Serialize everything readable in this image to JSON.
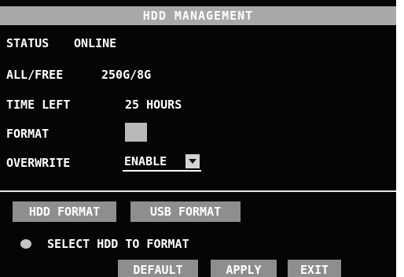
{
  "title": "HDD MANAGEMENT",
  "status": {
    "label": "STATUS",
    "value": "ONLINE"
  },
  "capacity": {
    "label": "ALL/FREE",
    "value": "250G/8G"
  },
  "time_left": {
    "label": "TIME LEFT",
    "value": "25 HOURS"
  },
  "format": {
    "label": "FORMAT",
    "checked": false
  },
  "overwrite": {
    "label": "OVERWRITE",
    "selected": "ENABLE"
  },
  "buttons": {
    "hdd_format": "HDD FORMAT",
    "usb_format": "USB FORMAT",
    "default": "DEFAULT",
    "apply": "APPLY",
    "exit": "EXIT"
  },
  "select_hdd": {
    "label": "SELECT HDD TO FORMAT",
    "selected": false
  },
  "colors": {
    "background": "#050505",
    "title_bar": "#a8a8a8",
    "button": "#8e8e8e",
    "text": "#ffffff"
  }
}
